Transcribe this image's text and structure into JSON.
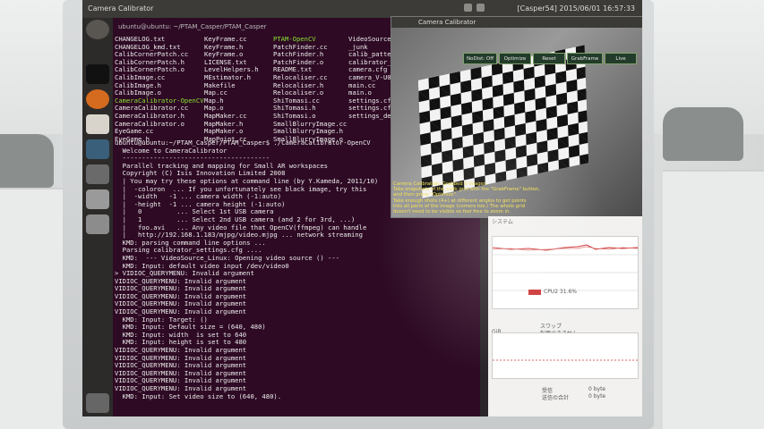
{
  "topbar": {
    "title": "Camera Calibrator",
    "status": "[Casper54] 2015/06/01 16:57:33"
  },
  "terminal": {
    "title": "ubuntu@ubuntu: ~/PTAM_Casper/PTAM_Casper",
    "files": [
      [
        "CHANGELOG.txt",
        "KeyFrame.cc",
        "PTAM-OpenCV",
        "VideoSource_"
      ],
      [
        "CHANGELOG_kmd.txt",
        "KeyFrame.h",
        "PatchFinder.cc",
        "_junk"
      ],
      [
        "CalibCornerPatch.cc",
        "KeyFrame.o",
        "PatchFinder.h",
        "calib_patte"
      ],
      [
        "CalibCornerPatch.h",
        "LICENSE.txt",
        "PatchFinder.o",
        "calibrator_"
      ],
      [
        "CalibCornerPatch.o",
        "LevelHelpers.h",
        "README.txt",
        "camera.cfg"
      ],
      [
        "CalibImage.cc",
        "MEstimator.h",
        "Relocaliser.cc",
        "camera_V-U06"
      ],
      [
        "CalibImage.h",
        "Makefile",
        "Relocaliser.h",
        "main.cc"
      ],
      [
        "CalibImage.o",
        "Map.cc",
        "Relocaliser.o",
        "main.o"
      ],
      [
        "CameraCalibrator-OpenCV",
        "Map.h",
        "ShiTomasi.cc",
        "settings.cfg"
      ],
      [
        "CameraCalibrator.cc",
        "Map.o",
        "ShiTomasi.h",
        "settings.cfg"
      ],
      [
        "CameraCalibrator.h",
        "MapMaker.cc",
        "ShiTomasi.o",
        "settings_def"
      ],
      [
        "CameraCalibrator.o",
        "MapMaker.h",
        "SmallBlurryImage.cc",
        ""
      ],
      [
        "EyeGame.cc",
        "MapMaker.o",
        "SmallBlurryImage.h",
        ""
      ],
      [
        "EyeGame.h",
        "MapPoint.cc",
        "SmallBlurryImage.o",
        ""
      ]
    ],
    "output": [
      "ubuntu@ubuntu:~/PTAM_Casper/PTAM_Casper$ ./CameraCalibrator-OpenCV",
      "  Welcome to CameraCalibrator",
      "  --------------------------------------",
      "  Parallel tracking and mapping for Small AR workspaces",
      "  Copyright (C) Isis Innovation Limited 2008",
      "",
      "  | You may try these options at command line (by Y.Kameda, 2011/10)",
      "  |  -coloron  ... If you unfortunately see black image, try this",
      "  |  -width   -1 ... camera width (-1:auto)",
      "  |  -height  -1 ... camera height (-1:auto)",
      "  |   0         ... Select 1st USB camera",
      "  |   1         ... Select 2nd USB camera (and 2 for 3rd, ...)",
      "  |   foo.avi   ... Any video file that OpenCV(ffmpeg) can handle",
      "  |   http://192.168.1.183/mjpg/video.mjpg ... network streaming",
      "",
      "  KMD: parsing command line options ...",
      "  Parsing calibrator_settings.cfg ....",
      "  KMD:  --- VideoSource_Linux: Opening video source () ---",
      "  KMD: Input: default video input /dev/video0",
      "> VIDIOC_QUERYMENU: Invalid argument",
      "VIDIOC_QUERYMENU: Invalid argument",
      "VIDIOC_QUERYMENU: Invalid argument",
      "VIDIOC_QUERYMENU: Invalid argument",
      "VIDIOC_QUERYMENU: Invalid argument",
      "VIDIOC_QUERYMENU: Invalid argument",
      "  KMD: Input: Target: ()",
      "  KMD: Input: Default size = (640, 480)",
      "  KMD: Input: width  is set to 640",
      "  KMD: Input: height is set to 480",
      "VIDIOC_QUERYMENU: Invalid argument",
      "VIDIOC_QUERYMENU: Invalid argument",
      "VIDIOC_QUERYMENU: Invalid argument",
      "VIDIOC_QUERYMENU: Invalid argument",
      "VIDIOC_QUERYMENU: Invalid argument",
      "VIDIOC_QUERYMENU: Invalid argument",
      "  KMD: Input: Set video size to (640, 480)."
    ]
  },
  "calibrator": {
    "title": "Camera Calibrator",
    "buttons": [
      "NoDist: Off",
      "Optimize",
      "Reset",
      "GrabFrame",
      "Live"
    ],
    "message": [
      "Camera Calibration: Grabbed 0 images.",
      "Take snapshots of the calib grid with the \"GrabFrame\" button,",
      "and then press \"Optimize\".",
      "Take enough shots (4+) at different angles to get points",
      "into all parts of the image (corners too.) The whole grid",
      "doesn't need to be visible so feel free to zoom in."
    ]
  },
  "monitor": {
    "header": "システム",
    "cpu_label": "CPU2 31.6%",
    "swap_label": "スワップ",
    "swap_value": "利用できません",
    "mem_label": "GiB",
    "net": [
      {
        "label": "受信",
        "value": "0 byte"
      },
      {
        "label": "送信の合計",
        "value": "0 byte"
      }
    ]
  }
}
